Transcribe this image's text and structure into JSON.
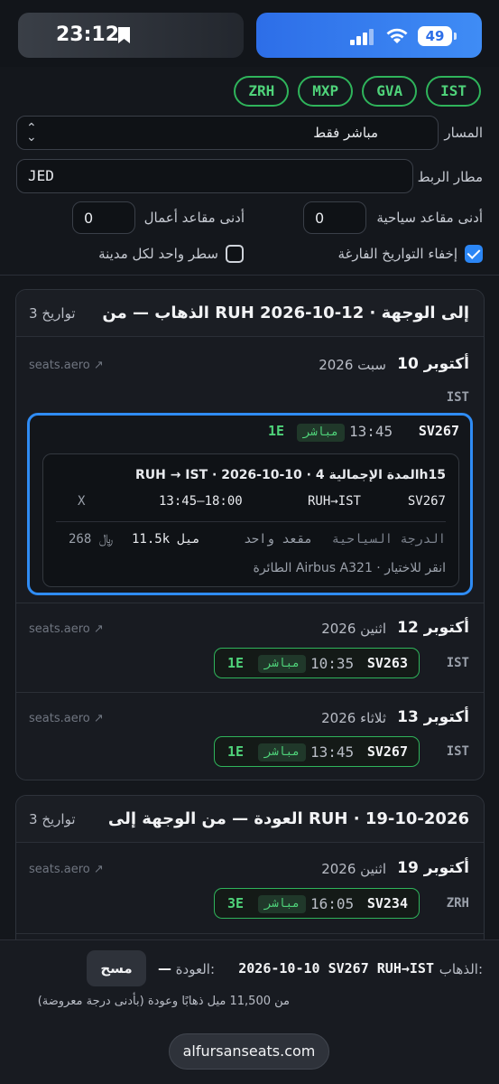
{
  "status": {
    "time": "23:12",
    "battery": "49"
  },
  "airports": [
    "ZRH",
    "MXP",
    "GVA",
    "IST"
  ],
  "form": {
    "route_label": "المسار",
    "route_value": "مباشر فقط",
    "hub_label": "مطار الربط",
    "hub_value": "JED",
    "min_economy_label": "أدنى مقاعد سياحية",
    "min_economy_value": "0",
    "min_business_label": "أدنى مقاعد أعمال",
    "min_business_value": "0",
    "hide_empty_label": "إخفاء التواريخ الفارغة",
    "one_row_label": "سطر واحد لكل مدينة"
  },
  "outbound": {
    "title": "الذهاب — من RUH إلى الوجهة · 12-10-2026",
    "count": "3 تواريخ",
    "days": [
      {
        "day": "10 أكتوبر",
        "month": "سبت 2026",
        "source": "seats.aero ↗",
        "dest": "IST",
        "flight": {
          "number": "SV267",
          "time": "13:45",
          "badge": "مباشر",
          "cls": "1E"
        },
        "detail": {
          "line1": "RUH → IST · 2026-10-10 · المدة الإجمالية 4h15",
          "seg_no": "SV267",
          "seg_route": "RUH→IST",
          "seg_time": "13:45–18:00",
          "seg_x": "X",
          "cabin": "الدرجة السياحية",
          "seats": "مقعد واحد",
          "miles": "11.5k ميل",
          "fee": "268 ﷼",
          "aircraft": "الطائرة Airbus A321 · انقر للاختيار"
        }
      },
      {
        "day": "12 أكتوبر",
        "month": "اثنين 2026",
        "source": "seats.aero ↗",
        "dest": "IST",
        "flight": {
          "number": "SV263",
          "time": "10:35",
          "badge": "مباشر",
          "cls": "1E"
        }
      },
      {
        "day": "13 أكتوبر",
        "month": "ثلاثاء 2026",
        "source": "seats.aero ↗",
        "dest": "IST",
        "flight": {
          "number": "SV267",
          "time": "13:45",
          "badge": "مباشر",
          "cls": "1E"
        }
      }
    ]
  },
  "inbound": {
    "title": "العودة — من الوجهة إلى RUH · 19-10-2026",
    "count": "3 تواريخ",
    "days": [
      {
        "day": "19 أكتوبر",
        "month": "اثنين 2026",
        "source": "seats.aero ↗",
        "dest": "ZRH",
        "flight": {
          "number": "SV234",
          "time": "16:05",
          "badge": "مباشر",
          "cls": "3E"
        }
      }
    ]
  },
  "summary": {
    "out_label": "الذهاب:",
    "out_value": "2026-10-10 SV267 RUH→IST",
    "ret_label": "العودة:",
    "ret_value": "—",
    "clear_label": "مسح",
    "miles_text": "من 11,500 ميل ذهابًا وعودة (بأدنى درجة معروضة)"
  },
  "url": "alfursanseats.com"
}
